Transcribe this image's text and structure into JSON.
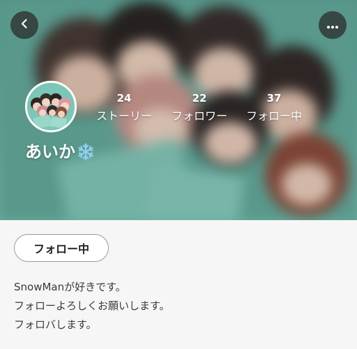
{
  "header": {
    "back_icon": "chevron-left-icon",
    "more_icon": "more-horizontal-icon"
  },
  "profile": {
    "username": "あいか",
    "username_emoji": "snowflake-icon",
    "stats": [
      {
        "value": "24",
        "label": "ストーリー"
      },
      {
        "value": "22",
        "label": "フォロワー"
      },
      {
        "value": "37",
        "label": "フォロー中"
      }
    ],
    "follow_button_label": "フォロー中",
    "bio_lines": [
      "SnowManが好きです。",
      "フォローよろしくお願いします。",
      "フォロバします。"
    ]
  },
  "colors": {
    "header_teal": "#6bb5a6",
    "snowflake": "#8fd0ee"
  }
}
